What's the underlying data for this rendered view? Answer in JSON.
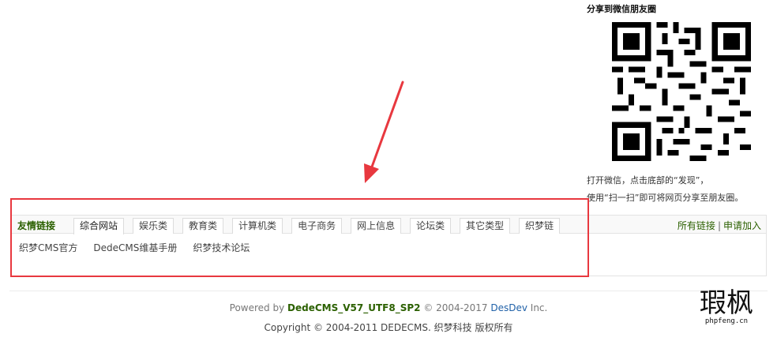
{
  "share": {
    "title": "分享到微信朋友圈",
    "line1": "打开微信，点击底部的“发现”，",
    "line2": "使用“扫一扫”即可将网页分享至朋友圈。"
  },
  "flink": {
    "title": "友情链接",
    "tabs": [
      "综合网站",
      "娱乐类",
      "教育类",
      "计算机类",
      "电子商务",
      "网上信息",
      "论坛类",
      "其它类型",
      "织梦链"
    ],
    "all_links": "所有链接",
    "sep": "|",
    "apply": "申请加入",
    "links": [
      "织梦CMS官方",
      "DedeCMS维基手册",
      "织梦技术论坛"
    ]
  },
  "footer": {
    "powered_prefix": "Powered by ",
    "version": "DedeCMS_V57_UTF8_SP2",
    "copy_years": " © 2004-2017 ",
    "dev": "DesDev",
    "inc": " Inc.",
    "copyright": "Copyright © 2004-2011 DEDECMS. 织梦科技 版权所有"
  },
  "watermark": {
    "logo": "瑕枫",
    "domain": "phpfeng.cn"
  },
  "colors": {
    "accent_green": "#2b6000",
    "highlight_red": "#e8383f",
    "link_blue": "#2061a8"
  }
}
